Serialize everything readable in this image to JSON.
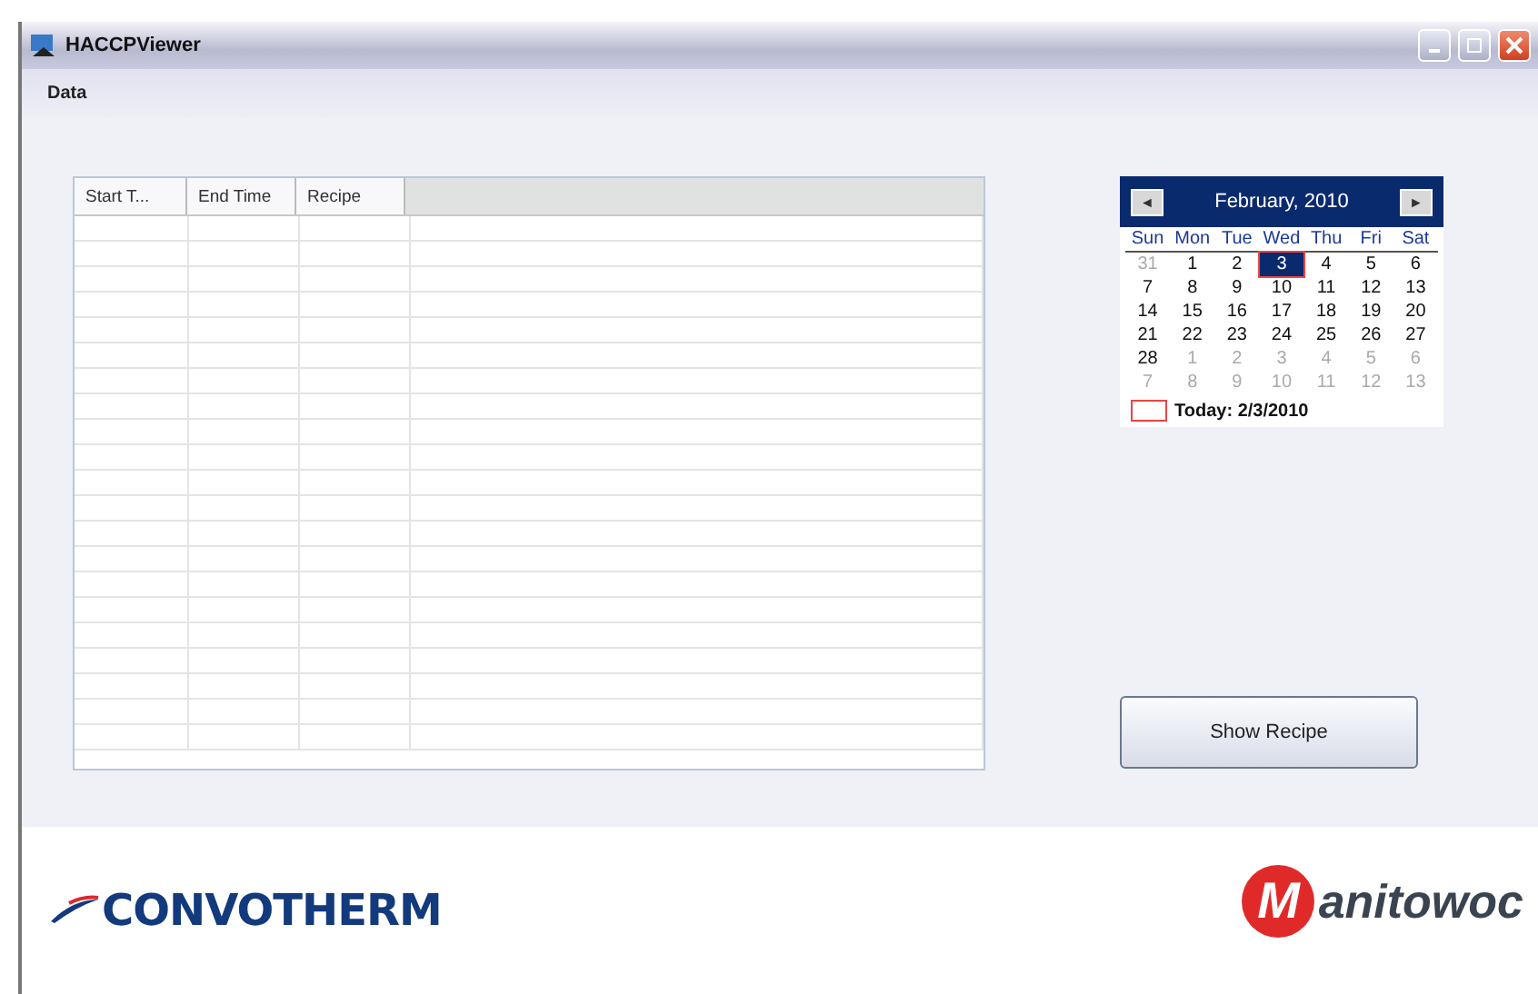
{
  "window": {
    "title": "HACCPViewer"
  },
  "menu": [
    "Data"
  ],
  "table": {
    "columns": [
      "Start T...",
      "End Time",
      "Recipe"
    ]
  },
  "calendar": {
    "month": "February, 2010",
    "prev": "◄",
    "next": "►",
    "day_names": [
      "Sun",
      "Mon",
      "Tue",
      "Wed",
      "Thu",
      "Fri",
      "Sat"
    ],
    "weeks": [
      [
        {
          "day": "31",
          "other_month": true,
          "selected": false
        },
        {
          "day": "1",
          "other_month": false,
          "selected": false
        },
        {
          "day": "2",
          "other_month": false,
          "selected": false
        },
        {
          "day": "3",
          "other_month": false,
          "selected": true
        },
        {
          "day": "4",
          "other_month": false,
          "selected": false
        },
        {
          "day": "5",
          "other_month": false,
          "selected": false
        },
        {
          "day": "6",
          "other_month": false,
          "selected": false
        }
      ],
      [
        {
          "day": "7",
          "other_month": false,
          "selected": false
        },
        {
          "day": "8",
          "other_month": false,
          "selected": false
        },
        {
          "day": "9",
          "other_month": false,
          "selected": false
        },
        {
          "day": "10",
          "other_month": false,
          "selected": false
        },
        {
          "day": "11",
          "other_month": false,
          "selected": false
        },
        {
          "day": "12",
          "other_month": false,
          "selected": false
        },
        {
          "day": "13",
          "other_month": false,
          "selected": false
        }
      ],
      [
        {
          "day": "14",
          "other_month": false,
          "selected": false
        },
        {
          "day": "15",
          "other_month": false,
          "selected": false
        },
        {
          "day": "16",
          "other_month": false,
          "selected": false
        },
        {
          "day": "17",
          "other_month": false,
          "selected": false
        },
        {
          "day": "18",
          "other_month": false,
          "selected": false
        },
        {
          "day": "19",
          "other_month": false,
          "selected": false
        },
        {
          "day": "20",
          "other_month": false,
          "selected": false
        }
      ],
      [
        {
          "day": "21",
          "other_month": false,
          "selected": false
        },
        {
          "day": "22",
          "other_month": false,
          "selected": false
        },
        {
          "day": "23",
          "other_month": false,
          "selected": false
        },
        {
          "day": "24",
          "other_month": false,
          "selected": false
        },
        {
          "day": "25",
          "other_month": false,
          "selected": false
        },
        {
          "day": "26",
          "other_month": false,
          "selected": false
        },
        {
          "day": "27",
          "other_month": false,
          "selected": false
        }
      ],
      [
        {
          "day": "28",
          "other_month": false,
          "selected": false
        },
        {
          "day": "1",
          "other_month": true,
          "selected": false
        },
        {
          "day": "2",
          "other_month": true,
          "selected": false
        },
        {
          "day": "3",
          "other_month": true,
          "selected": false
        },
        {
          "day": "4",
          "other_month": true,
          "selected": false
        },
        {
          "day": "5",
          "other_month": true,
          "selected": false
        },
        {
          "day": "6",
          "other_month": true,
          "selected": false
        }
      ],
      [
        {
          "day": "7",
          "other_month": true,
          "selected": false
        },
        {
          "day": "8",
          "other_month": true,
          "selected": false
        },
        {
          "day": "9",
          "other_month": true,
          "selected": false
        },
        {
          "day": "10",
          "other_month": true,
          "selected": false
        },
        {
          "day": "11",
          "other_month": true,
          "selected": false
        },
        {
          "day": "12",
          "other_month": true,
          "selected": false
        },
        {
          "day": "13",
          "other_month": true,
          "selected": false
        }
      ]
    ],
    "today": "Today: 2/3/2010"
  },
  "button": "Show Recipe",
  "logos": {
    "convotherm": "CONVOTHERM",
    "manitowoc_mark": "M",
    "manitowoc_text": "anitowoc"
  }
}
